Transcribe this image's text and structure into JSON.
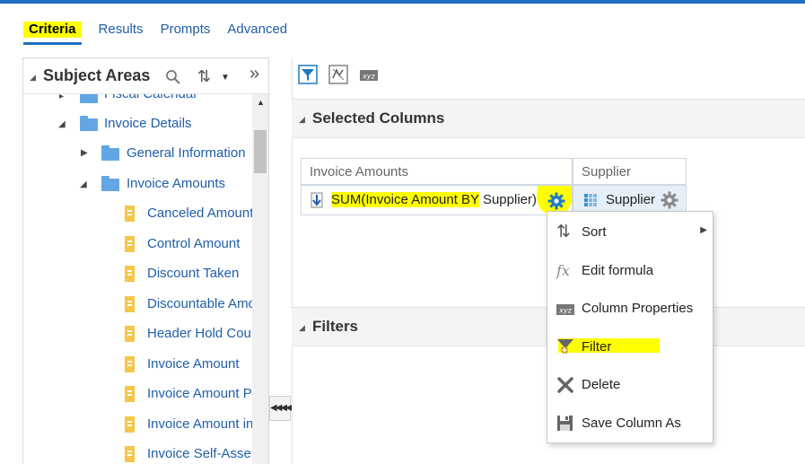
{
  "tabs": [
    {
      "label": "Criteria",
      "active": true
    },
    {
      "label": "Results",
      "active": false
    },
    {
      "label": "Prompts",
      "active": false
    },
    {
      "label": "Advanced",
      "active": false
    }
  ],
  "subject_areas": {
    "title": "Subject Areas",
    "search_icon": "search-icon",
    "sort_icon": "sort-icon",
    "expand_icon": "double-chevron-right-icon",
    "tree": {
      "clipped_item": "Fiscal Calendar",
      "invoice_details": "Invoice Details",
      "general_information": "General Information",
      "invoice_amounts": "Invoice Amounts",
      "columns": [
        "Canceled Amount",
        "Control Amount",
        "Discount Taken",
        "Discountable Amc",
        "Header Hold Cou",
        "Invoice Amount",
        "Invoice Amount P",
        "Invoice Amount in",
        "Invoice Self-Asse"
      ]
    }
  },
  "toolbar": {
    "icons": [
      "filter-icon",
      "remove-all-icon",
      "xyz-properties-icon"
    ]
  },
  "selected_columns": {
    "title": "Selected Columns",
    "col1_header": "Invoice Amounts",
    "col1_value_highlight": "SUM(Invoice Amount BY",
    "col1_value_rest": " Supplier)",
    "col2_header": "Supplier",
    "col2_value": "Supplier"
  },
  "filters": {
    "title": "Filters"
  },
  "context_menu": {
    "items": [
      {
        "label": "Sort",
        "icon": "sort-icon",
        "submenu": true
      },
      {
        "label": "Edit formula",
        "icon": "fx-icon",
        "submenu": false
      },
      {
        "label": "Column Properties",
        "icon": "xyz-icon",
        "submenu": false
      },
      {
        "label": "Filter",
        "icon": "filter-add-icon",
        "submenu": false
      },
      {
        "label": "Delete",
        "icon": "delete-x-icon",
        "submenu": false
      },
      {
        "label": "Save Column As",
        "icon": "save-icon",
        "submenu": false
      }
    ]
  },
  "colors": {
    "accent": "#1f70c1",
    "link": "#1f5ea8",
    "highlight": "#ffff00",
    "folder": "#63a6e6",
    "column_icon": "#f5c64a",
    "selected_cell_bg": "#e6eef8",
    "gear_blue": "#1e7ac4"
  }
}
